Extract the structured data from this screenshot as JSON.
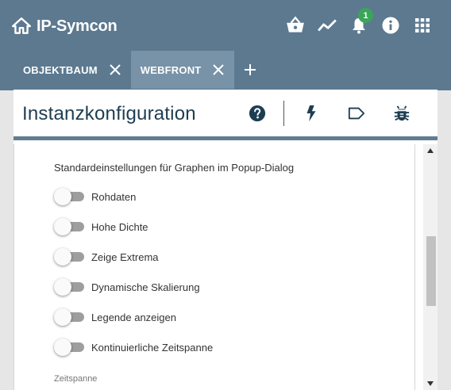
{
  "app": {
    "title": "IP-Symcon",
    "notification_count": "1"
  },
  "header_icons": [
    "basket-icon",
    "trend-icon",
    "bell-icon",
    "info-icon",
    "apps-grid-icon"
  ],
  "tabs": [
    {
      "label": "OBJEKTBAUM",
      "active": false
    },
    {
      "label": "WEBFRONT",
      "active": true
    }
  ],
  "dialog": {
    "title": "Instanzkonfiguration",
    "toolbar_icons": [
      "help-icon",
      "flash-icon",
      "tag-icon",
      "bug-icon"
    ],
    "section_label": "Standardeinstellungen für Graphen im Popup-Dialog",
    "toggles": [
      {
        "label": "Rohdaten",
        "on": false
      },
      {
        "label": "Hohe Dichte",
        "on": false
      },
      {
        "label": "Zeige Extrema",
        "on": false
      },
      {
        "label": "Dynamische Skalierung",
        "on": false
      },
      {
        "label": "Legende anzeigen",
        "on": false
      },
      {
        "label": "Kontinuierliche Zeitspanne",
        "on": false
      }
    ],
    "next_field_label": "Zeitspanne"
  },
  "colors": {
    "header_bg": "#5c7990",
    "active_tab_bg": "#7892a7",
    "badge": "#3ba559",
    "title_text": "#1e3d52"
  }
}
